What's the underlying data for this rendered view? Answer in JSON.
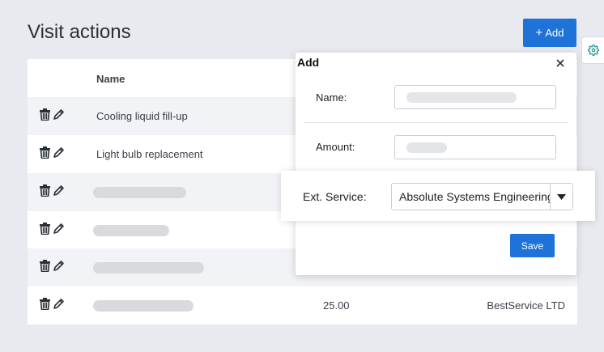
{
  "page": {
    "title": "Visit actions"
  },
  "toolbar": {
    "add_label": "Add",
    "add_icon": "plus-icon",
    "settings_icon": "gear-icon"
  },
  "table": {
    "columns": [
      "Name"
    ],
    "rows": [
      {
        "name": "Cooling liquid fill-up",
        "amount": "",
        "service": ""
      },
      {
        "name": "Light bulb replacement",
        "amount": "",
        "service": ""
      },
      {
        "name": "",
        "amount": "",
        "service": ""
      },
      {
        "name": "",
        "amount": "",
        "service": ""
      },
      {
        "name": "",
        "amount": "",
        "service": ""
      },
      {
        "name": "",
        "amount": "25.00",
        "service": "BestService LTD"
      }
    ],
    "row_icons": [
      "trash-icon",
      "pencil-icon"
    ]
  },
  "add_popup": {
    "title": "Add",
    "name_label": "Name:",
    "amount_label": "Amount:",
    "ext_service_label": "Ext. Service:",
    "ext_service_value": "Absolute Systems Engineering",
    "save_label": "Save"
  },
  "colors": {
    "accent": "#1f73d8",
    "background": "#e8eaf0",
    "row_shade": "#f2f3f6"
  }
}
